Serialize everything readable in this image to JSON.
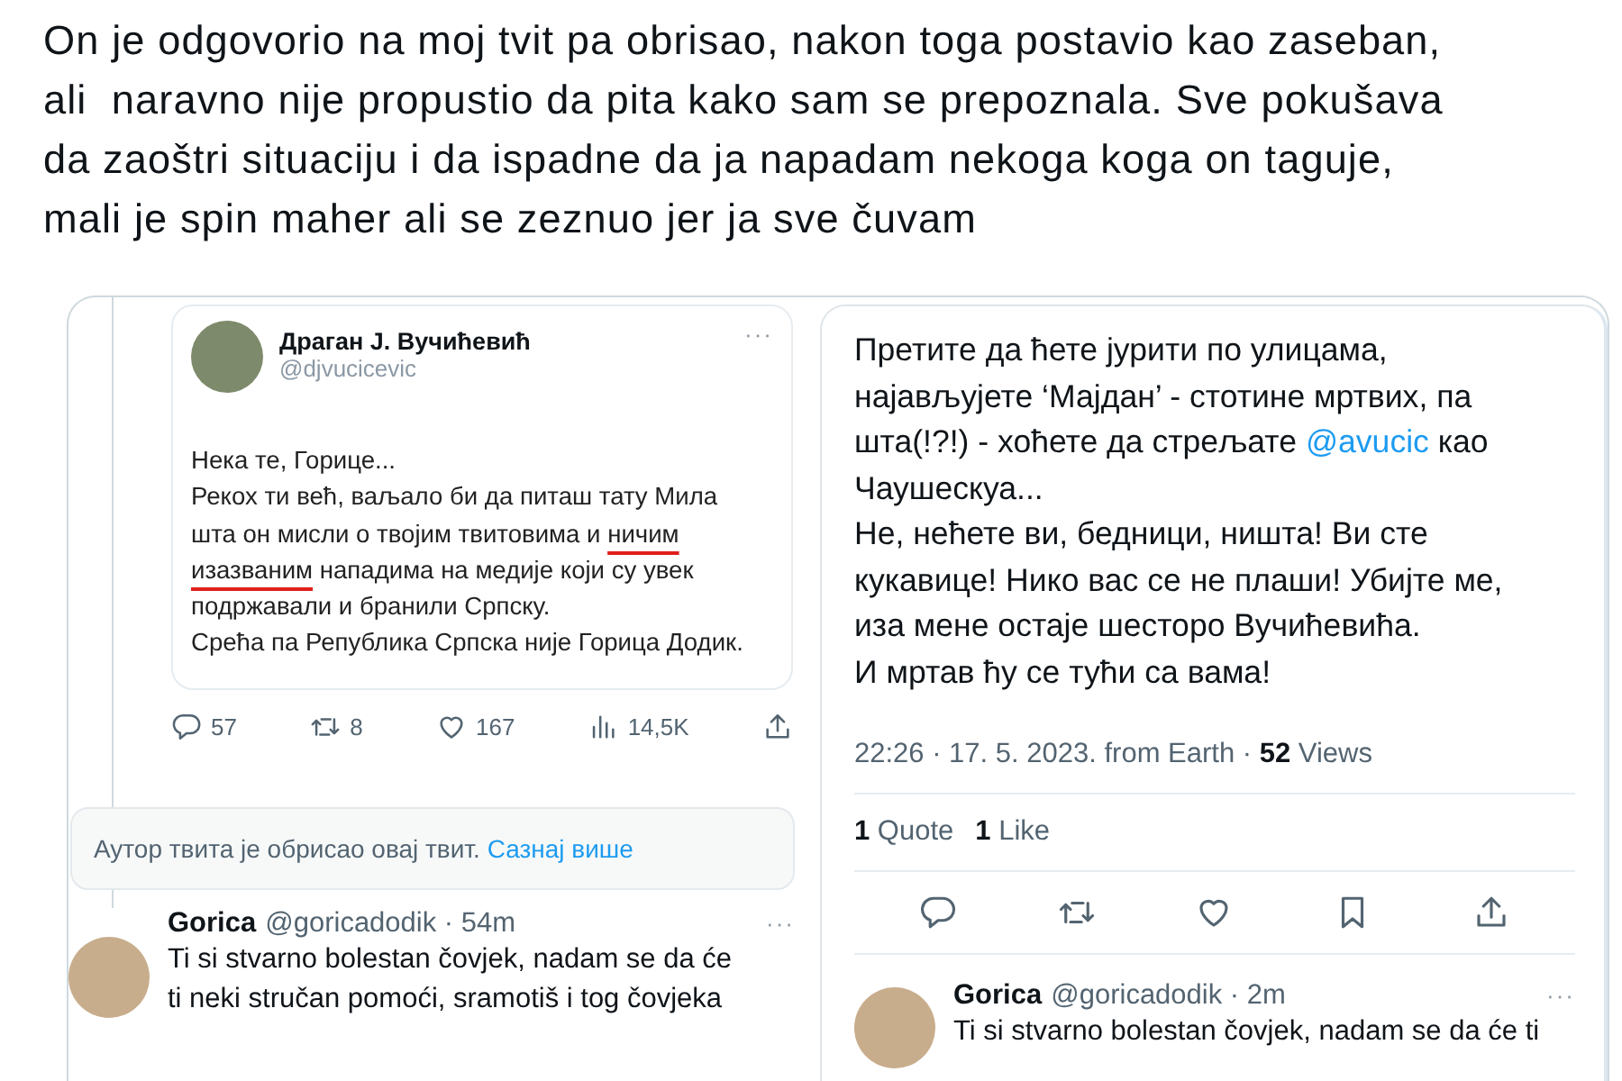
{
  "post": {
    "text": "On je odgovorio na moj tvit pa obrisao, nakon toga postavio kao zaseban, ali  naravno nije propustio da pita kako sam se prepoznala. Sve pokušava da zaoštri situaciju i da ispadne da ja napadam nekoga koga on taguje, mali je spin maher ali se zeznuo jer ja sve čuvam"
  },
  "left_screenshot": {
    "quoted_tweet": {
      "author": "Драган Ј. Вучићевић",
      "handle": "@djvucicevic",
      "menu": "···",
      "paragraphs": [
        [
          {
            "kind": "text",
            "text": "Нека те, Горице..."
          }
        ],
        [
          {
            "kind": "text",
            "text": "Рекох ти већ, ваљало би да питаш тату Мила шта он мисли о твојим твитовима и "
          },
          {
            "kind": "underlined",
            "text": "ничим изазваним"
          },
          {
            "kind": "text",
            "text": " нападима на медије који су увек подржавали и бранили Српску."
          }
        ],
        [
          {
            "kind": "text",
            "text": "Срећа па Република Српска није Горица Додик."
          }
        ]
      ]
    },
    "actions": [
      {
        "kind": "reply",
        "count": "57"
      },
      {
        "kind": "retweet",
        "count": "8"
      },
      {
        "kind": "like",
        "count": "167"
      },
      {
        "kind": "views",
        "count": "14,5K"
      },
      {
        "kind": "share"
      }
    ],
    "deleted_notice": {
      "text": "Аутор твита је обрисао овај твит.",
      "link": "Сазнај више"
    },
    "reply": {
      "name": "Gorica",
      "handle": "@goricadodik · 54m",
      "menu": "···",
      "text": "Ti si stvarno bolestan čovjek, nadam se da će ti neki stručan pomoći, sramotiš i tog čovjeka"
    }
  },
  "right_screenshot": {
    "paragraphs": [
      [
        {
          "kind": "text",
          "text": "Претите да ћете јурити по улицама, најављујете ‘Мајдан’ - стотине мртвих, па шта(!?!) - хоћете да стрељате "
        },
        {
          "kind": "mention",
          "text": "@avucic"
        },
        {
          "kind": "text",
          "text": " као Чаушескуа..."
        }
      ],
      [
        {
          "kind": "text",
          "text": "Не, нећете ви, бедници, ништа! Ви сте кукавице! Нико вас се не плаши! Убијте ме, иза мене остаје шесторо Вучићевића."
        }
      ],
      [
        {
          "kind": "text",
          "text": "И мртав ћу се тући са вама!"
        }
      ]
    ],
    "meta": "22:26 · 17. 5. 2023. from Earth · **52** Views",
    "stats": [
      "**1** Quote",
      "**1** Like"
    ],
    "actions": [
      {
        "kind": "reply"
      },
      {
        "kind": "retweet"
      },
      {
        "kind": "like"
      },
      {
        "kind": "bookmark"
      },
      {
        "kind": "share"
      }
    ],
    "reply": {
      "name": "Gorica",
      "handle": "@goricadodik · 2m",
      "menu": "···",
      "text": "Ti si stvarno bolestan čovjek, nadam se da će ti"
    }
  }
}
